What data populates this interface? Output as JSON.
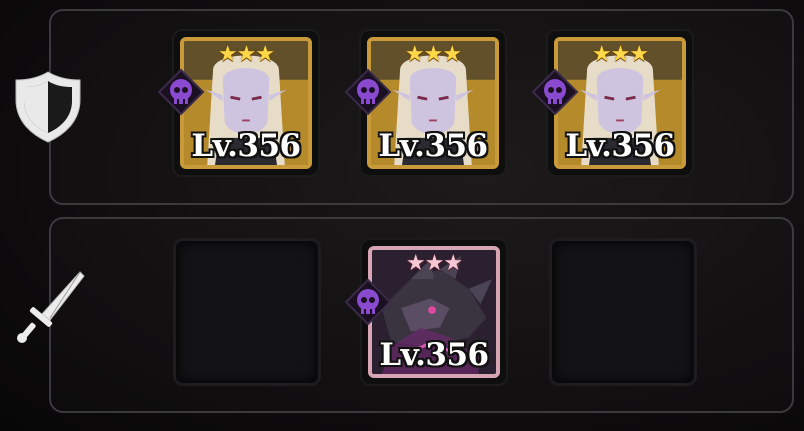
{
  "defense_row": {
    "icon": "shield-icon",
    "slots": [
      {
        "filled": true,
        "frame": "gold",
        "stars": "★★★",
        "level": "Lv.356",
        "faction_icon": "skull-faction-icon",
        "portrait": "elf-woman-portrait"
      },
      {
        "filled": true,
        "frame": "gold",
        "stars": "★★★",
        "level": "Lv.356",
        "faction_icon": "skull-faction-icon",
        "portrait": "elf-woman-portrait"
      },
      {
        "filled": true,
        "frame": "gold",
        "stars": "★★★",
        "level": "Lv.356",
        "faction_icon": "skull-faction-icon",
        "portrait": "elf-woman-portrait"
      }
    ]
  },
  "attack_row": {
    "icon": "sword-icon",
    "slots": [
      {
        "filled": false
      },
      {
        "filled": true,
        "frame": "pink",
        "stars": "★★★",
        "level": "Lv.356",
        "faction_icon": "skull-faction-icon",
        "portrait": "dark-dragon-portrait"
      },
      {
        "filled": false
      }
    ]
  },
  "colors": {
    "gold_frame": "#c99a3a",
    "pink_frame": "#d6a6b4",
    "faction_purple": "#7b3fb8",
    "panel_border": "#3a3a3e"
  }
}
